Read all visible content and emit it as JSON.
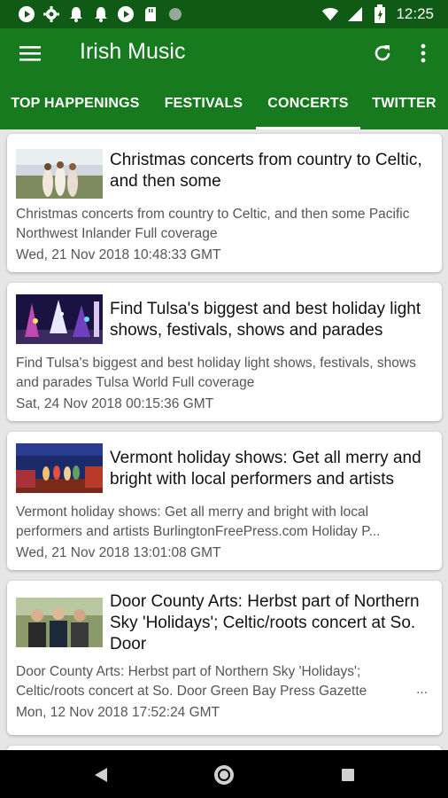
{
  "status": {
    "time": "12:25"
  },
  "app": {
    "title": "Irish Music"
  },
  "tabs": [
    {
      "label": "TOP HAPPENINGS"
    },
    {
      "label": "FESTIVALS"
    },
    {
      "label": "CONCERTS"
    },
    {
      "label": "TWITTER"
    }
  ],
  "articles": [
    {
      "title": "Christmas concerts from country to Celtic, and then some",
      "desc": "Christmas concerts from country to Celtic, and then some Pacific Northwest Inlander  Full coverage",
      "date": "Wed, 21 Nov 2018 10:48:33 GMT"
    },
    {
      "title": "Find Tulsa's biggest and best holiday light shows, festivals, shows and parades",
      "desc": "Find Tulsa's biggest and best holiday light shows, festivals, shows and parades  Tulsa World  Full coverage",
      "date": "Sat, 24 Nov 2018 00:15:36 GMT"
    },
    {
      "title": "Vermont holiday shows: Get all merry and bright with local performers and artists",
      "desc": "Vermont holiday shows: Get all merry and bright with local performers and artists  BurlingtonFreePress.com  Holiday P...",
      "date": "Wed, 21 Nov 2018 13:01:08 GMT"
    },
    {
      "title": "Door County Arts: Herbst part of Northern Sky 'Holidays'; Celtic/roots concert at So. Door",
      "desc": "Door County Arts: Herbst part of Northern Sky 'Holidays'; Celtic/roots concert at So. Door  Green Bay Press Gazette",
      "more": "...",
      "date": "Mon, 12 Nov 2018 17:52:24 GMT"
    }
  ],
  "colors": {
    "toolbar": "#187a1f",
    "statusbar": "#0f5a14"
  }
}
